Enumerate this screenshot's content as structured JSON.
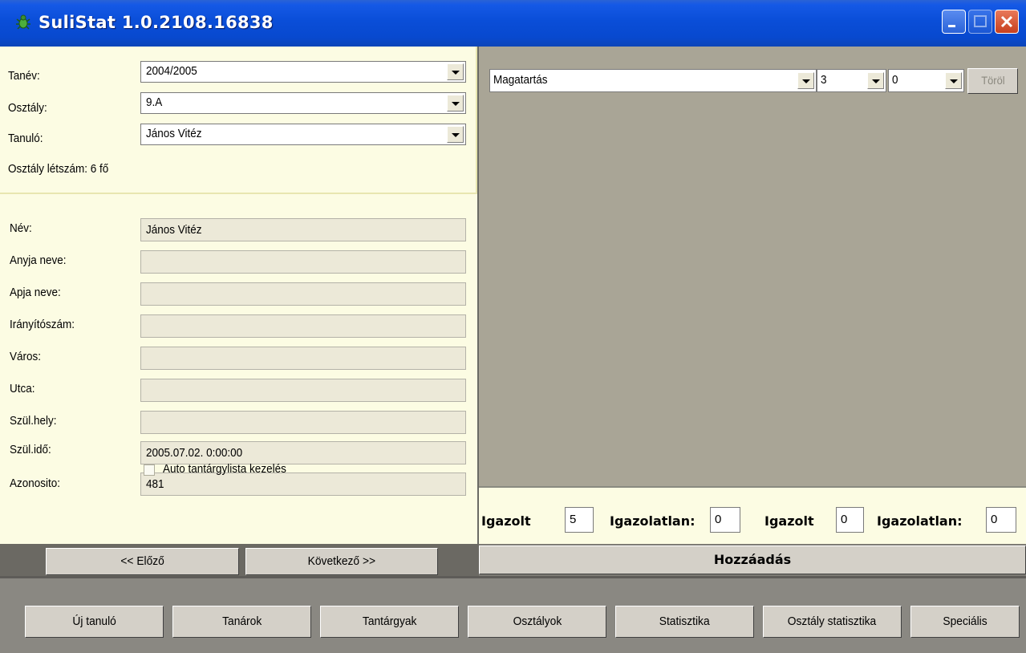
{
  "window": {
    "title": "SuliStat 1.0.2108.16838"
  },
  "selectors": {
    "tanev_label": "Tanév:",
    "tanev_value": "2004/2005",
    "osztaly_label": "Osztály:",
    "osztaly_value": "9.A",
    "tanulo_label": "Tanuló:",
    "tanulo_value": "János Vitéz",
    "letszam": "Osztály létszám: 6 fő"
  },
  "details": {
    "nev_label": "Név:",
    "nev_value": "János Vitéz",
    "anyja_label": "Anyja neve:",
    "anyja_value": "",
    "apja_label": "Apja neve:",
    "apja_value": "",
    "irsz_label": "Irányítószám:",
    "irsz_value": "",
    "varos_label": "Város:",
    "varos_value": "",
    "utca_label": "Utca:",
    "utca_value": "",
    "szulhely_label": "Szül.hely:",
    "szulhely_value": "",
    "szulido_label": "Szül.idő:",
    "szulido_value": "2005.07.02. 0:00:00",
    "azon_label": "Azonosito:",
    "azon_value": "481",
    "auto_label": "Auto tantárgylista kezelés"
  },
  "nav": {
    "prev": "<< Előző",
    "next": "Következő >>"
  },
  "grade_row": {
    "subject": "Magatartás",
    "grade": "3",
    "second": "0",
    "delete": "Töröl"
  },
  "absence": {
    "igazolt1_label": "Igazolt",
    "igazolt1_value": "5",
    "igazolatlan1_label": "Igazolatlan:",
    "igazolatlan1_value": "0",
    "igazolt2_label": "Igazolt",
    "igazolt2_value": "0",
    "igazolatlan2_label": "Igazolatlan:",
    "igazolatlan2_value": "0"
  },
  "add_button": "Hozzáadás",
  "bottom": {
    "uj_tanulo": "Új tanuló",
    "tanarok": "Tanárok",
    "tantargyak": "Tantárgyak",
    "osztalyok": "Osztályok",
    "statisztika": "Statisztika",
    "osztaly_stat": "Osztály statisztika",
    "specialis": "Speciális"
  }
}
